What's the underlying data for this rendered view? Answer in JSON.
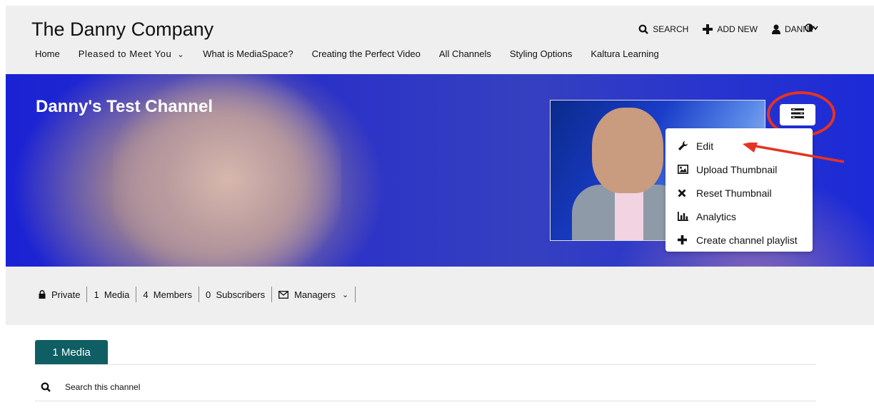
{
  "header": {
    "site_title": "The Danny Company",
    "actions": {
      "search": "SEARCH",
      "add_new": "ADD NEW",
      "user": "DANNY"
    },
    "nav": [
      {
        "label": "Home"
      },
      {
        "label": "Pleased to Meet You"
      },
      {
        "label": "What is MediaSpace?"
      },
      {
        "label": "Creating the Perfect Video"
      },
      {
        "label": "All Channels"
      },
      {
        "label": "Styling Options"
      },
      {
        "label": "Kaltura Learning"
      }
    ]
  },
  "banner": {
    "channel_title": "Danny's Test Channel"
  },
  "actions_menu": {
    "items": [
      {
        "label": "Edit",
        "icon": "wrench-icon"
      },
      {
        "label": "Upload Thumbnail",
        "icon": "image-icon"
      },
      {
        "label": "Reset Thumbnail",
        "icon": "x-icon"
      },
      {
        "label": "Analytics",
        "icon": "bar-chart-icon"
      },
      {
        "label": "Create channel playlist",
        "icon": "plus-icon"
      }
    ]
  },
  "stats": {
    "privacy": "Private",
    "media": "1  Media",
    "members": "4  Members",
    "subscribers": "0  Subscribers",
    "managers": "Managers"
  },
  "tabs": {
    "media_tab": "1 Media"
  },
  "search": {
    "label": "Search this channel"
  },
  "colors": {
    "tab_bg": "#0f5e63",
    "highlight": "#e53322",
    "header_bg": "#efefef"
  }
}
